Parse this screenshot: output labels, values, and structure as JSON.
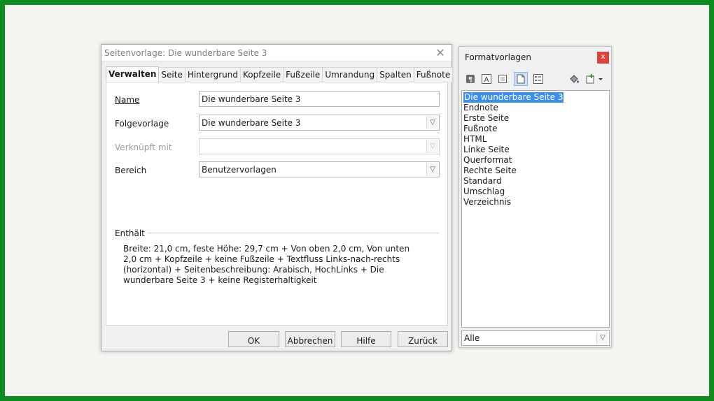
{
  "dialog": {
    "title": "Seitenvorlage: Die wunderbare Seite 3",
    "tabs": [
      "Verwalten",
      "Seite",
      "Hintergrund",
      "Kopfzeile",
      "Fußzeile",
      "Umrandung",
      "Spalten",
      "Fußnote"
    ],
    "active_tab": "Verwalten",
    "fields": {
      "name_label": "Name",
      "name_value": "Die wunderbare Seite 3",
      "next_label": "Folgevorlage",
      "next_value": "Die wunderbare Seite 3",
      "linked_label": "Verknüpft mit",
      "linked_value": "",
      "category_label": "Bereich",
      "category_value": "Benutzervorlagen"
    },
    "contains_label": "Enthält",
    "contains_text": "Breite: 21,0 cm, feste Höhe: 29,7 cm + Von oben 2,0 cm, Von unten 2,0 cm + Kopfzeile + keine Fußzeile + Textfluss Links-nach-rechts (horizontal) + Seitenbeschreibung: Arabisch, HochLinks + Die wunderbare Seite 3 + keine Registerhaltigkeit",
    "buttons": {
      "ok": "OK",
      "cancel": "Abbrechen",
      "help": "Hilfe",
      "reset": "Zurück"
    }
  },
  "styles_panel": {
    "title": "Formatvorlagen",
    "close": "x",
    "icons": [
      "paragraph-styles-icon",
      "character-styles-icon",
      "frame-styles-icon",
      "page-styles-icon",
      "list-styles-icon",
      "fill-format-icon",
      "new-style-icon"
    ],
    "items": [
      "Die wunderbare Seite 3",
      "Endnote",
      "Erste Seite",
      "Fußnote",
      "HTML",
      "Linke Seite",
      "Querformat",
      "Rechte Seite",
      "Standard",
      "Umschlag",
      "Verzeichnis"
    ],
    "selected_item": "Die wunderbare Seite 3",
    "filter_value": "Alle"
  },
  "colors": {
    "frame": "#0f8a1e",
    "selection": "#3d8ee6",
    "close_button": "#d9453c"
  }
}
